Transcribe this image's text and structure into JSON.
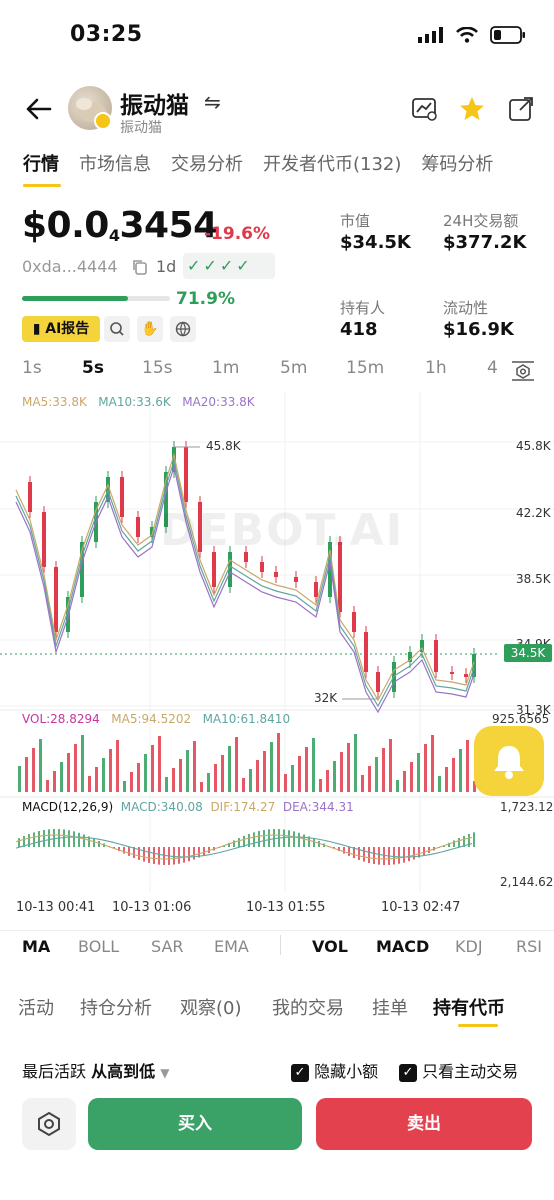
{
  "status_bar": {
    "time": "03:25"
  },
  "token": {
    "name": "振动猫",
    "symbol_sub": "振动猫"
  },
  "tabs": [
    "行情",
    "市场信息",
    "交易分析",
    "开发者代币(132)",
    "筹码分析"
  ],
  "price": {
    "prefix": "$0.0",
    "zeros_sub": "4",
    "digits": "3454",
    "change": "-19.6%",
    "address": "0xda...4444",
    "timeframe": "1d",
    "checks": "✓✓✓✓",
    "progress_text": "71.9%",
    "progress_fraction": 0.719
  },
  "actions": {
    "ai_report": "AI报告"
  },
  "stats": [
    {
      "label": "市值",
      "value": "$34.5K"
    },
    {
      "label": "24H交易额",
      "value": "$377.2K"
    },
    {
      "label": "持有人",
      "value": "418"
    },
    {
      "label": "流动性",
      "value": "$16.9K"
    }
  ],
  "intervals": [
    "1s",
    "5s",
    "15s",
    "1m",
    "5m",
    "15m",
    "1h",
    "4"
  ],
  "active_interval": "5s",
  "chart": {
    "ma_legend": {
      "ma5": "MA5:33.8K",
      "ma10": "MA10:33.6K",
      "ma20": "MA20:33.8K"
    },
    "price_axis": [
      "45.8K",
      "42.2K",
      "38.5K",
      "34.9K",
      "31.3K"
    ],
    "high_label": "45.8K",
    "low_label": "32K",
    "current_tag": "34.5K",
    "watermark": "DEBOT.AI",
    "vol_legend": {
      "vol": "VOL:28.8294",
      "ma5": "MA5:94.5202",
      "ma10": "MA10:61.8410",
      "max": "925.6565"
    },
    "macd_legend": {
      "name": "MACD(12,26,9)",
      "macd": "MACD:340.08",
      "dif": "DIF:174.27",
      "dea": "DEA:344.31",
      "top": "1,723.12",
      "bottom": "2,144.62"
    },
    "time_labels": [
      "10-13 00:41",
      "10-13 01:06",
      "10-13 01:55",
      "10-13 02:47"
    ],
    "colors": {
      "up": "#2e9e5b",
      "down": "#e0394a",
      "ma5": "#c9a868",
      "ma10": "#5fa6a0",
      "ma20": "#9b72c9"
    }
  },
  "indicators": {
    "main": [
      "MA",
      "BOLL",
      "SAR",
      "EMA"
    ],
    "sub": [
      "VOL",
      "MACD",
      "KDJ",
      "RSI"
    ],
    "main_active": "MA",
    "sub_active": [
      "VOL",
      "MACD"
    ]
  },
  "sub_tabs": [
    "活动",
    "持仓分析",
    "观察(0)",
    "我的交易",
    "挂单",
    "持有代币"
  ],
  "sort": {
    "label": "最后活跃",
    "order": "从高到低",
    "hide_small": "隐藏小额",
    "active_only": "只看主动交易"
  },
  "buttons": {
    "buy": "买入",
    "sell": "卖出"
  }
}
